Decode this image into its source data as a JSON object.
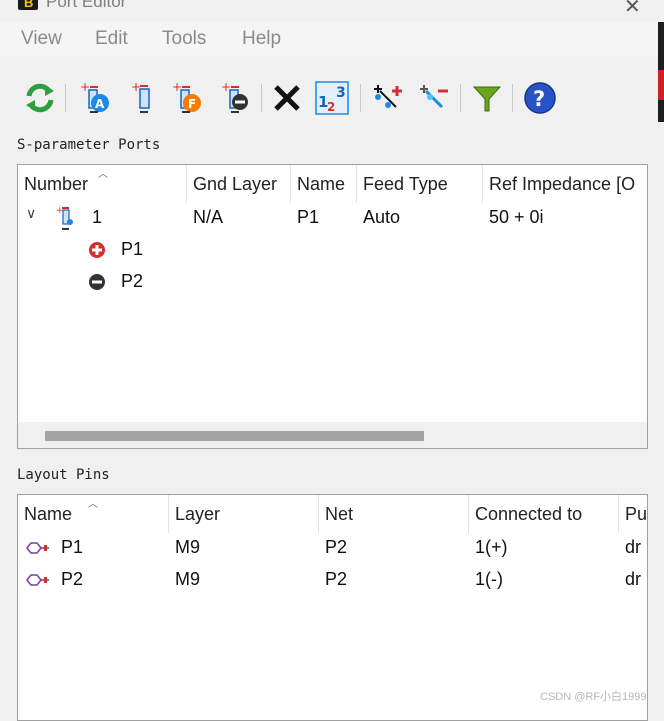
{
  "window": {
    "title": "Port Editor"
  },
  "menu": [
    "View",
    "Edit",
    "Tools",
    "Help"
  ],
  "toolbar": [
    {
      "name": "refresh-icon"
    },
    {
      "name": "add-port-a-icon"
    },
    {
      "name": "add-port-icon"
    },
    {
      "name": "add-port-f-icon"
    },
    {
      "name": "add-ground-port-icon"
    },
    {
      "name": "delete-icon"
    },
    {
      "name": "renumber-icon"
    },
    {
      "name": "add-pin-icon"
    },
    {
      "name": "remove-pin-icon"
    },
    {
      "name": "filter-icon"
    },
    {
      "name": "help-icon"
    }
  ],
  "sparam": {
    "label": "S-parameter Ports",
    "columns": [
      "Number",
      "Gnd Layer",
      "Name",
      "Feed Type",
      "Ref Impedance [O"
    ],
    "port": {
      "number": "1",
      "gnd_layer": "N/A",
      "name": "P1",
      "feed_type": "Auto",
      "ref_impedance": "50 + 0i"
    },
    "children": [
      {
        "label": "P1",
        "polarity": "plus"
      },
      {
        "label": "P2",
        "polarity": "minus"
      }
    ]
  },
  "pins": {
    "label": "Layout Pins",
    "columns": [
      "Name",
      "Layer",
      "Net",
      "Connected to",
      "Pu"
    ],
    "rows": [
      {
        "name": "P1",
        "layer": "M9",
        "net": "P2",
        "connected": "1(+)",
        "pu": "dr"
      },
      {
        "name": "P2",
        "layer": "M9",
        "net": "P2",
        "connected": "1(-)",
        "pu": "dr"
      }
    ]
  },
  "watermark": "CSDN @RF小白1999",
  "colors": {
    "accent": "#1565c0",
    "red": "#d32f2f",
    "green": "#2e9e3e"
  }
}
